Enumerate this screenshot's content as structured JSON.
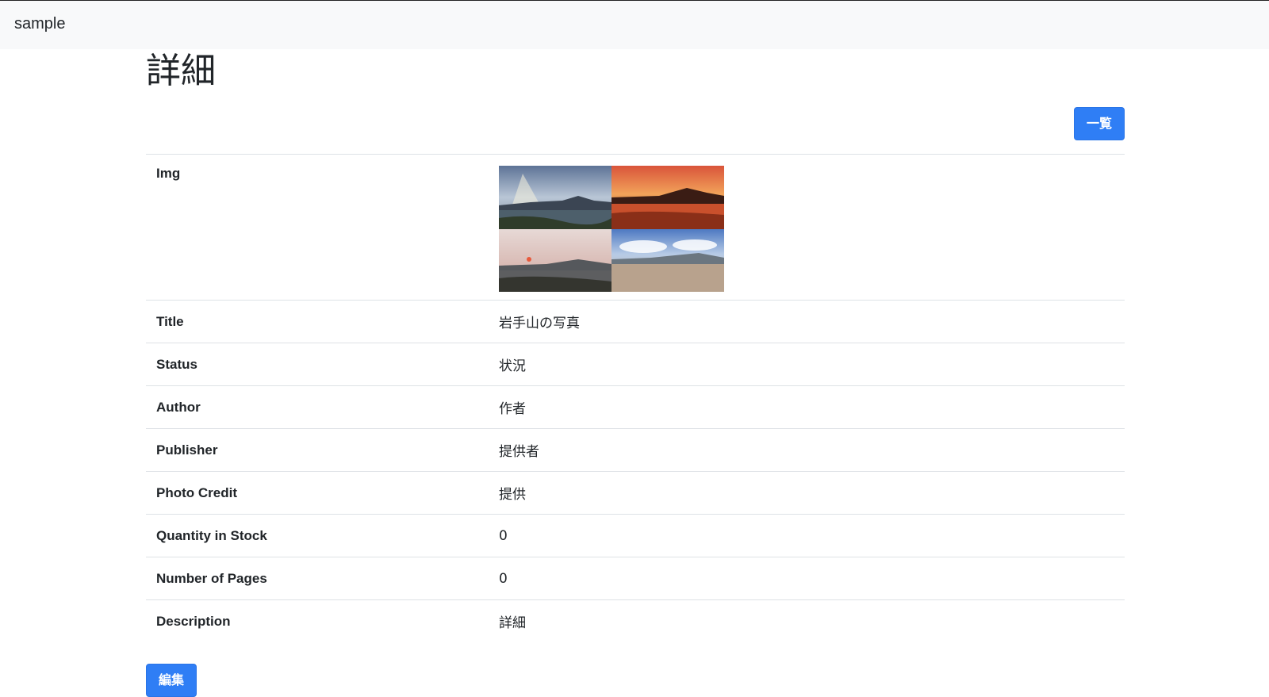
{
  "navbar": {
    "brand": "sample"
  },
  "page": {
    "title": "詳細"
  },
  "buttons": {
    "list_label": "一覧",
    "edit_label": "編集"
  },
  "details": {
    "img_label": "Img",
    "rows": [
      {
        "label": "Title",
        "value": "岩手山の写真"
      },
      {
        "label": "Status",
        "value": "状況"
      },
      {
        "label": "Author",
        "value": "作者"
      },
      {
        "label": "Publisher",
        "value": "提供者"
      },
      {
        "label": "Photo Credit",
        "value": "提供"
      },
      {
        "label": "Quantity in Stock",
        "value": "0"
      },
      {
        "label": "Number of Pages",
        "value": "0"
      },
      {
        "label": "Description",
        "value": "詳細"
      }
    ]
  },
  "colors": {
    "primary": "#2f7ef5",
    "navbar_bg": "#f8f9fa"
  }
}
